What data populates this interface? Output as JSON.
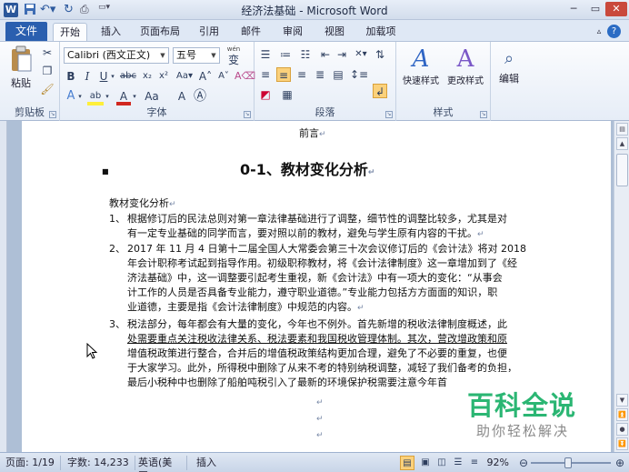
{
  "window": {
    "title": "经济法基础 - Microsoft Word"
  },
  "quick_access": {
    "icons": [
      "word-app-icon",
      "save-icon",
      "undo-icon",
      "redo-icon",
      "print-preview-icon",
      "customize-qat-icon"
    ]
  },
  "tabs": [
    {
      "label": "文件"
    },
    {
      "label": "开始"
    },
    {
      "label": "插入"
    },
    {
      "label": "页面布局"
    },
    {
      "label": "引用"
    },
    {
      "label": "邮件"
    },
    {
      "label": "审阅"
    },
    {
      "label": "视图"
    },
    {
      "label": "加载项"
    }
  ],
  "ribbon": {
    "clipboard": {
      "label": "剪贴板",
      "paste_label": "粘贴"
    },
    "font": {
      "label": "字体",
      "font_name": "Calibri (西文正文)",
      "font_size": "五号",
      "wen_glyph": "wén",
      "wen_char": "变"
    },
    "paragraph": {
      "label": "段落"
    },
    "styles": {
      "label": "样式",
      "quick_styles_label": "快速样式",
      "change_styles_label": "更改样式"
    },
    "editing": {
      "label": "编辑"
    }
  },
  "document": {
    "header_text": "前言",
    "heading": "0-1、教材变化分析",
    "subheading": "教材变化分析",
    "items": [
      {
        "num": "1、",
        "lines": [
          "根据修订后的民法总则对第一章法律基础进行了调整，细节性的调整比较多，尤其是对",
          "有一定专业基础的同学而言，要对照以前的教材，避免与学生原有内容的干扰。"
        ]
      },
      {
        "num": "2、",
        "lines": [
          "2017 年 11 月 4 日第十二届全国人大常委会第三十次会议修订后的《会计法》将对 2018",
          "年会计职称考试起到指导作用。初级职称教材，将《会计法律制度》这一章增加到了《经",
          "济法基础》中，这一调整要引起考生重视，新《会计法》中有一项大的变化：“从事会",
          "计工作的人员是否具备专业能力，遵守职业道德。”专业能力包括方方面面的知识，职",
          "业道德，主要是指《会计法律制度》中规范的内容。"
        ]
      },
      {
        "num": "3、",
        "lines": [
          "税法部分，每年都会有大量的变化，今年也不例外。首先新增的税收法律制度概述，此",
          "处需要重点关注税收法律关系、税法要素和我国税收管理体制。其次，营改增政策和原",
          "增值税政策进行整合，合并后的增值税政策结构更加合理，避免了不必要的重复，也便",
          "于大家学习。此外，所得税中删除了从来不考的特别纳税调整，减轻了我们备考的负担，",
          "最后小税种中也删除了船舶吨税引入了最新的环境保护税需要注意今年首"
        ]
      }
    ]
  },
  "status": {
    "page": "页面: 1/19",
    "words": "字数: 14,233",
    "language": "英语(美国)",
    "mode": "插入",
    "zoom": "92%",
    "zoom_fraction": 0.46
  },
  "watermark": {
    "title": "百科全说",
    "subtitle": "助你轻松解决"
  }
}
